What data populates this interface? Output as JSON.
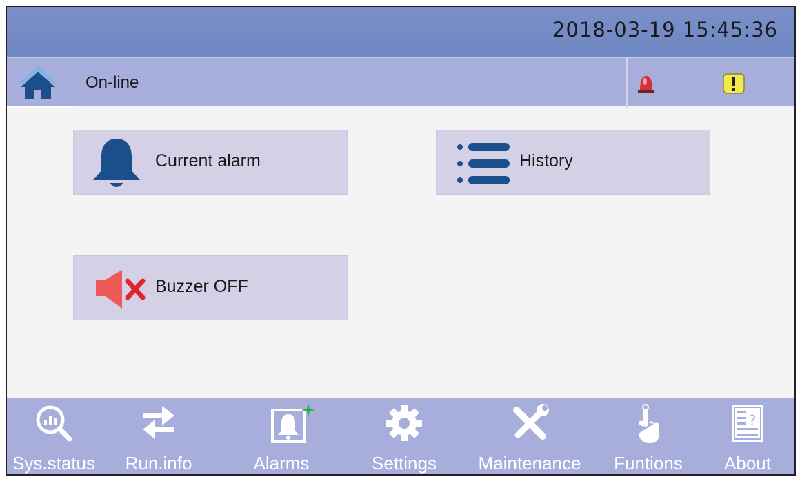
{
  "header": {
    "datetime": "2018-03-19  15:45:36"
  },
  "status": {
    "mode": "On-line"
  },
  "tiles": {
    "current_alarm": "Current alarm",
    "history": "History",
    "buzzer_off": "Buzzer OFF"
  },
  "nav": [
    {
      "label": "Sys.status",
      "icon": "magnifier-chart-icon"
    },
    {
      "label": "Run.info",
      "icon": "swap-arrows-icon"
    },
    {
      "label": "Alarms",
      "icon": "bell-frame-icon"
    },
    {
      "label": "Settings",
      "icon": "gear-icon"
    },
    {
      "label": "Maintenance",
      "icon": "tools-icon"
    },
    {
      "label": "Funtions",
      "icon": "hand-pointer-icon"
    },
    {
      "label": "About",
      "icon": "document-icon"
    }
  ],
  "colors": {
    "topbar": "#7990c8",
    "statusbar": "#a7aedc",
    "tile": "#d4d0e6",
    "icon_blue": "#1a4f8c",
    "alarm_red": "#e0383e",
    "warn_yellow": "#f2e94e"
  }
}
